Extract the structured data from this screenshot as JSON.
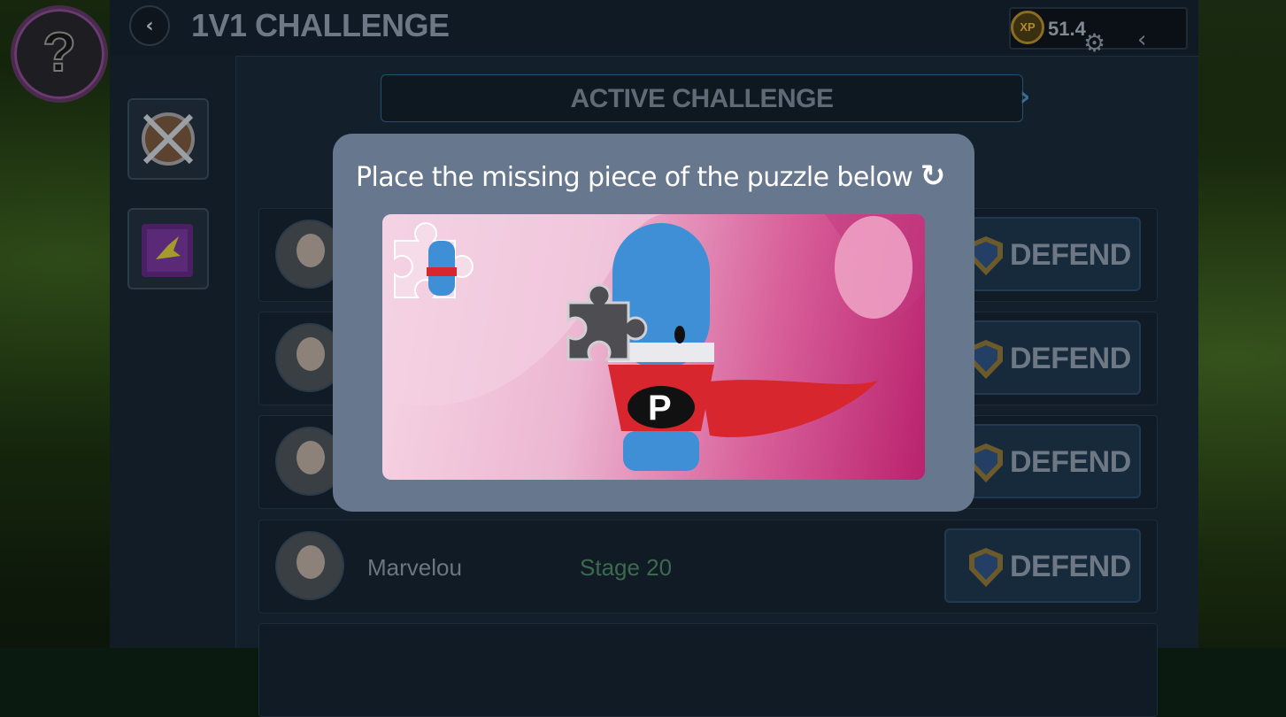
{
  "header": {
    "back_icon": "chevron-left-icon",
    "title": "1V1 CHALLENGE",
    "xp_badge": "XP",
    "xp_value": "51.4"
  },
  "tabs": {
    "active_label": "ACTIVE CHALLENGE"
  },
  "rows": [
    {
      "name": "",
      "stage": "",
      "action": "DEFEND"
    },
    {
      "name": "",
      "stage": "",
      "action": "DEFEND"
    },
    {
      "name": "",
      "stage": "",
      "action": "DEFEND"
    },
    {
      "name": "Marvelou",
      "stage": "Stage 20",
      "action": "DEFEND"
    }
  ],
  "captcha": {
    "title": "Place the missing piece of the puzzle below",
    "refresh_icon": "refresh-icon"
  },
  "colors": {
    "modal_bg": "#67778d",
    "panel_bg": "#13202c",
    "defend_btn": "#162a3b",
    "stage_text": "#3d6a4e"
  }
}
